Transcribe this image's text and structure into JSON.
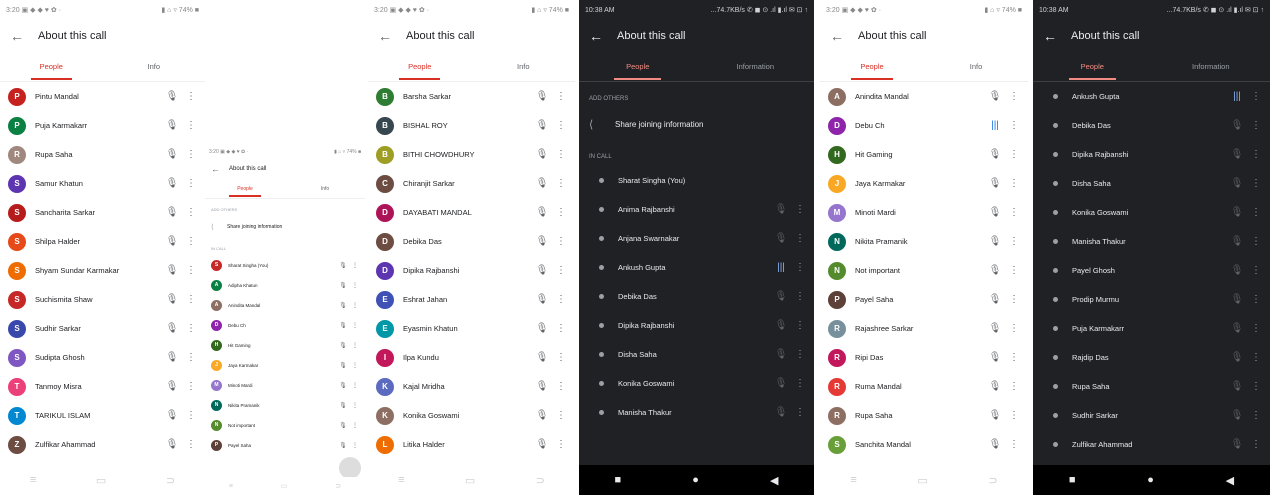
{
  "status": {
    "light_left": "3:20 ▣ ◆ ◆ ♥ ✿ ·",
    "light_right": "▮ ⌂ ▿ 74% ■",
    "dark_left": "10:38 AM",
    "dark_right": "...74.7KB/s ✆ ◼ ⊙ .ıl ▮.ıl ✉ ⊡ ↑"
  },
  "appbar": {
    "title": "About this call",
    "back": "←"
  },
  "tabs": {
    "people": "People",
    "info": "Info",
    "information": "Information"
  },
  "sections": {
    "add_others": "ADD OTHERS",
    "in_call": "IN CALL"
  },
  "share_label": "Share joining information",
  "icons": {
    "mic": "🎙",
    "more": "⋮",
    "share": "⟨",
    "mic_active": "|||"
  },
  "colors": {
    "accent": "#d93025",
    "dark_bg": "#202124"
  },
  "panel1": [
    {
      "initial": "P",
      "name": "Pintu Mandal",
      "color": "#c5221f"
    },
    {
      "initial": "P",
      "name": "Puja Karmakarr",
      "color": "#0b8043"
    },
    {
      "initial": "R",
      "name": "Rupa Saha",
      "color": "#a1887f"
    },
    {
      "initial": "S",
      "name": "Samur Khatun",
      "color": "#5e35b1"
    },
    {
      "initial": "S",
      "name": "Sancharita Sarkar",
      "color": "#b71c1c"
    },
    {
      "initial": "S",
      "name": "Shilpa Halder",
      "color": "#e64a19"
    },
    {
      "initial": "S",
      "name": "Shyam Sundar Karmakar",
      "color": "#ef6c00"
    },
    {
      "initial": "S",
      "name": "Suchismita Shaw",
      "color": "#c62828"
    },
    {
      "initial": "S",
      "name": "Sudhir Sarkar",
      "color": "#3949ab"
    },
    {
      "initial": "S",
      "name": "Sudipta Ghosh",
      "color": "#7e57c2"
    },
    {
      "initial": "T",
      "name": "Tanmoy Misra",
      "color": "#ec407a"
    },
    {
      "initial": "T",
      "name": "TARIKUL ISLAM",
      "color": "#0288d1"
    },
    {
      "initial": "Z",
      "name": "Zulfikar Ahammad",
      "color": "#6d4c41"
    }
  ],
  "mini_list": [
    {
      "initial": "S",
      "name": "Sharat Singha (You)",
      "color": "#c62828"
    },
    {
      "initial": "A",
      "name": "Adipha Khatun",
      "color": "#0b8043"
    },
    {
      "initial": "A",
      "name": "Anindita Mandal",
      "color": "#8d6e63"
    },
    {
      "initial": "D",
      "name": "Debu Ch",
      "color": "#8e24aa"
    },
    {
      "initial": "H",
      "name": "Hit Gaming",
      "color": "#33691e"
    },
    {
      "initial": "J",
      "name": "Jaya Karmakar",
      "color": "#f9a825"
    },
    {
      "initial": "M",
      "name": "Minoti Mardi",
      "color": "#9575cd"
    },
    {
      "initial": "N",
      "name": "Nikita Pramanik",
      "color": "#00695c"
    },
    {
      "initial": "N",
      "name": "Not important",
      "color": "#558b2f"
    },
    {
      "initial": "P",
      "name": "Payel Saha",
      "color": "#5d4037"
    }
  ],
  "panel2": [
    {
      "initial": "B",
      "name": "Barsha Sarkar",
      "color": "#2e7d32"
    },
    {
      "initial": "B",
      "name": "BISHAL ROY",
      "color": "#37474f"
    },
    {
      "initial": "B",
      "name": "BITHI CHOWDHURY",
      "color": "#9e9d24"
    },
    {
      "initial": "C",
      "name": "Chiranjit Sarkar",
      "color": "#6d4c41"
    },
    {
      "initial": "D",
      "name": "DAYABATI MANDAL",
      "color": "#ad1457"
    },
    {
      "initial": "D",
      "name": "Debika Das",
      "color": "#6d4c41"
    },
    {
      "initial": "D",
      "name": "Dipika Rajbanshi",
      "color": "#5e35b1"
    },
    {
      "initial": "E",
      "name": "Eshrat Jahan",
      "color": "#3f51b5"
    },
    {
      "initial": "E",
      "name": "Eyasmin Khatun",
      "color": "#0097a7"
    },
    {
      "initial": "I",
      "name": "Ilpa Kundu",
      "color": "#c2185b"
    },
    {
      "initial": "K",
      "name": "Kajal Mridha",
      "color": "#5c6bc0"
    },
    {
      "initial": "K",
      "name": "Konika Goswami",
      "color": "#8d6e63"
    },
    {
      "initial": "L",
      "name": "Litika Halder",
      "color": "#ef6c00"
    }
  ],
  "panel3": [
    {
      "name": "Sharat Singha (You)",
      "mic": "none"
    },
    {
      "name": "Anima Rajbanshi",
      "mic": "muted"
    },
    {
      "name": "Anjana Swarnakar",
      "mic": "muted"
    },
    {
      "name": "Ankush Gupta",
      "mic": "active"
    },
    {
      "name": "Debika Das",
      "mic": "muted"
    },
    {
      "name": "Dipika Rajbanshi",
      "mic": "muted"
    },
    {
      "name": "Disha Saha",
      "mic": "muted"
    },
    {
      "name": "Konika Goswami",
      "mic": "muted"
    },
    {
      "name": "Manisha Thakur",
      "mic": "muted"
    }
  ],
  "panel4": [
    {
      "initial": "A",
      "name": "Anindita Mandal",
      "color": "#8d6e63",
      "mic": "muted"
    },
    {
      "initial": "D",
      "name": "Debu Ch",
      "color": "#8e24aa",
      "mic": "active"
    },
    {
      "initial": "H",
      "name": "Hit Gaming",
      "color": "#33691e",
      "mic": "muted"
    },
    {
      "initial": "J",
      "name": "Jaya Karmakar",
      "color": "#f9a825",
      "mic": "muted"
    },
    {
      "initial": "M",
      "name": "Minoti Mardi",
      "color": "#9575cd",
      "mic": "muted"
    },
    {
      "initial": "N",
      "name": "Nikita Pramanik",
      "color": "#00695c",
      "mic": "muted"
    },
    {
      "initial": "N",
      "name": "Not important",
      "color": "#558b2f",
      "mic": "muted"
    },
    {
      "initial": "P",
      "name": "Payel Saha",
      "color": "#5d4037",
      "mic": "muted"
    },
    {
      "initial": "R",
      "name": "Rajashree Sarkar",
      "color": "#78909c",
      "mic": "muted"
    },
    {
      "initial": "R",
      "name": "Ripi Das",
      "color": "#c2185b",
      "mic": "muted"
    },
    {
      "initial": "R",
      "name": "Ruma Mandal",
      "color": "#e53935",
      "mic": "muted"
    },
    {
      "initial": "R",
      "name": "Rupa Saha",
      "color": "#8d6e63",
      "mic": "muted"
    },
    {
      "initial": "S",
      "name": "Sanchita Mandal",
      "color": "#689f38",
      "mic": "muted"
    }
  ],
  "panel5": [
    {
      "name": "Ankush Gupta",
      "mic": "active"
    },
    {
      "name": "Debika Das",
      "mic": "muted"
    },
    {
      "name": "Dipika Rajbanshi",
      "mic": "muted"
    },
    {
      "name": "Disha Saha",
      "mic": "muted"
    },
    {
      "name": "Konika Goswami",
      "mic": "muted"
    },
    {
      "name": "Manisha Thakur",
      "mic": "muted"
    },
    {
      "name": "Payel Ghosh",
      "mic": "muted"
    },
    {
      "name": "Prodip Murmu",
      "mic": "muted"
    },
    {
      "name": "Puja Karmakarr",
      "mic": "muted"
    },
    {
      "name": "Rajdip Das",
      "mic": "muted"
    },
    {
      "name": "Rupa Saha",
      "mic": "muted"
    },
    {
      "name": "Sudhir Sarkar",
      "mic": "muted"
    },
    {
      "name": "Zulfikar Ahammad",
      "mic": "muted"
    }
  ],
  "navbar": {
    "light": [
      "≡",
      "▭",
      "⊃"
    ],
    "dark": [
      "■",
      "●",
      "◀"
    ]
  }
}
